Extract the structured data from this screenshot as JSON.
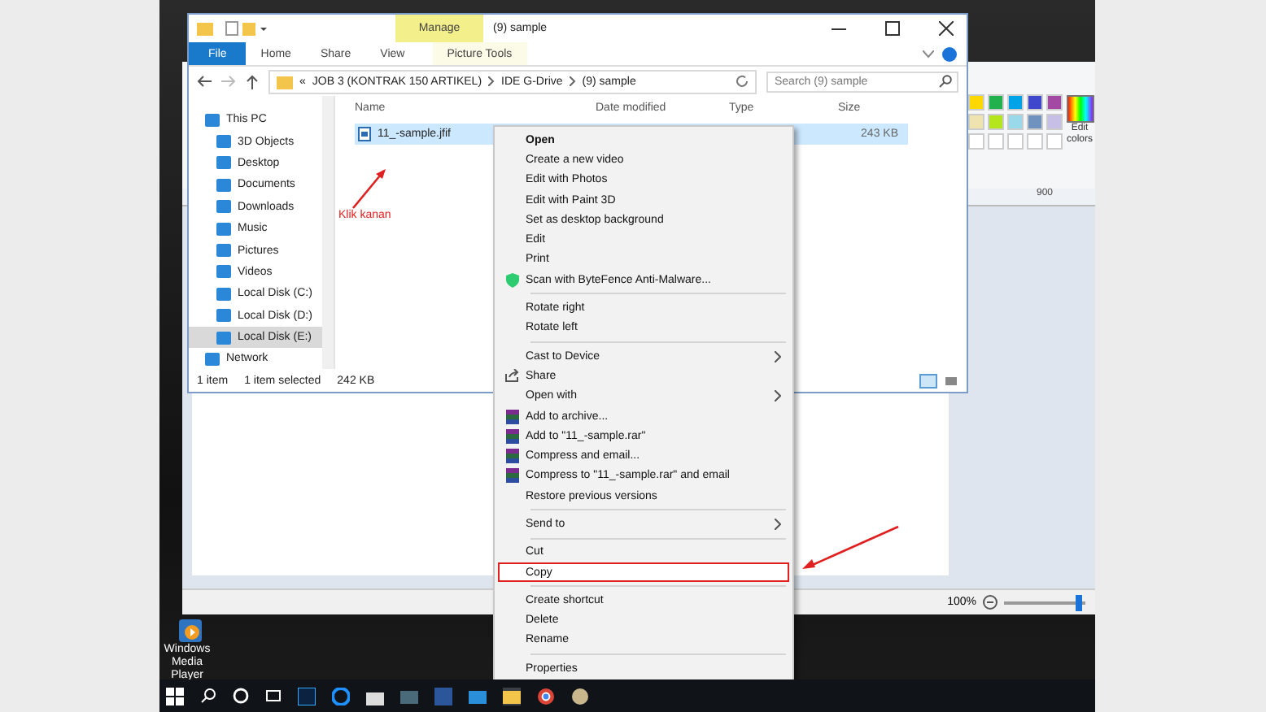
{
  "desktop": {
    "icon_label": "Windows Media Player"
  },
  "paint": {
    "edit_colors": "Edit colors",
    "ruler_mark": "900",
    "zoom": "100%",
    "zoom_level": {
      "level": 0.92
    }
  },
  "explorer": {
    "title": "(9) sample",
    "context_group": "Manage",
    "ribbon_tabs": [
      {
        "label": "File",
        "kind": "file",
        "selected": false
      },
      {
        "label": "Home",
        "kind": "tab",
        "selected": false
      },
      {
        "label": "Share",
        "kind": "tab",
        "selected": false
      },
      {
        "label": "View",
        "kind": "tab",
        "selected": false
      },
      {
        "label": "Picture Tools",
        "kind": "context",
        "selected": false
      }
    ],
    "breadcrumbs": [
      "«",
      "JOB 3 (KONTRAK 150 ARTIKEL)",
      "IDE G-Drive",
      "(9) sample"
    ],
    "search": {
      "placeholder": "Search (9) sample"
    },
    "nav": [
      {
        "label": "This PC",
        "selected": false,
        "children": [
          {
            "label": "3D Objects",
            "selected": false
          },
          {
            "label": "Desktop",
            "selected": false
          },
          {
            "label": "Documents",
            "selected": false
          },
          {
            "label": "Downloads",
            "selected": false
          },
          {
            "label": "Music",
            "selected": false
          },
          {
            "label": "Pictures",
            "selected": false
          },
          {
            "label": "Videos",
            "selected": false
          },
          {
            "label": "Local Disk (C:)",
            "selected": false
          },
          {
            "label": "Local Disk (D:)",
            "selected": false
          },
          {
            "label": "Local Disk (E:)",
            "selected": true
          }
        ]
      },
      {
        "label": "Network",
        "selected": false
      }
    ],
    "columns": [
      "Name",
      "Date modified",
      "Type",
      "Size"
    ],
    "files": [
      {
        "name": "11_-sample.jfif",
        "size": "243 KB",
        "selected": true
      }
    ],
    "status": {
      "count": "1 item",
      "selected": "1 item selected",
      "size": "242 KB"
    }
  },
  "context_menu": {
    "groups": [
      [
        {
          "label": "Open",
          "kind": "plain",
          "default": true,
          "submenu": false,
          "marked": false
        },
        {
          "label": "Create a new video",
          "kind": "plain",
          "default": false,
          "submenu": false,
          "marked": false
        },
        {
          "label": "Edit with Photos",
          "kind": "plain",
          "default": false,
          "submenu": false,
          "marked": false
        },
        {
          "label": "Edit with Paint 3D",
          "kind": "plain",
          "default": false,
          "submenu": false,
          "marked": false
        },
        {
          "label": "Set as desktop background",
          "kind": "plain",
          "default": false,
          "submenu": false,
          "marked": false
        },
        {
          "label": "Edit",
          "kind": "plain",
          "default": false,
          "submenu": false,
          "marked": false
        },
        {
          "label": "Print",
          "kind": "plain",
          "default": false,
          "submenu": false,
          "marked": false
        },
        {
          "label": "Scan with ByteFence Anti-Malware...",
          "kind": "scan",
          "default": false,
          "submenu": false,
          "marked": false
        }
      ],
      [
        {
          "label": "Rotate right",
          "kind": "plain",
          "default": false,
          "submenu": false,
          "marked": false
        },
        {
          "label": "Rotate left",
          "kind": "plain",
          "default": false,
          "submenu": false,
          "marked": false
        }
      ],
      [
        {
          "label": "Cast to Device",
          "kind": "plain",
          "default": false,
          "submenu": true,
          "marked": false
        },
        {
          "label": "Share",
          "kind": "share",
          "default": false,
          "submenu": false,
          "marked": false
        },
        {
          "label": "Open with",
          "kind": "plain",
          "default": false,
          "submenu": true,
          "marked": false
        },
        {
          "label": "Add to archive...",
          "kind": "archive",
          "default": false,
          "submenu": false,
          "marked": false
        },
        {
          "label": "Add to \"11_-sample.rar\"",
          "kind": "archive",
          "default": false,
          "submenu": false,
          "marked": false
        },
        {
          "label": "Compress and email...",
          "kind": "archive",
          "default": false,
          "submenu": false,
          "marked": false
        },
        {
          "label": "Compress to \"11_-sample.rar\" and email",
          "kind": "archive",
          "default": false,
          "submenu": false,
          "marked": false
        },
        {
          "label": "Restore previous versions",
          "kind": "plain",
          "default": false,
          "submenu": false,
          "marked": false
        }
      ],
      [
        {
          "label": "Send to",
          "kind": "plain",
          "default": false,
          "submenu": true,
          "marked": false
        }
      ],
      [
        {
          "label": "Cut",
          "kind": "plain",
          "default": false,
          "submenu": false,
          "marked": false
        },
        {
          "label": "Copy",
          "kind": "plain",
          "default": false,
          "submenu": false,
          "marked": true
        }
      ],
      [
        {
          "label": "Create shortcut",
          "kind": "plain",
          "default": false,
          "submenu": false,
          "marked": false
        },
        {
          "label": "Delete",
          "kind": "plain",
          "default": false,
          "submenu": false,
          "marked": false
        },
        {
          "label": "Rename",
          "kind": "plain",
          "default": false,
          "submenu": false,
          "marked": false
        }
      ],
      [
        {
          "label": "Properties",
          "kind": "plain",
          "default": false,
          "submenu": false,
          "marked": false
        }
      ]
    ]
  },
  "annotation": {
    "label": "Klik kanan"
  }
}
